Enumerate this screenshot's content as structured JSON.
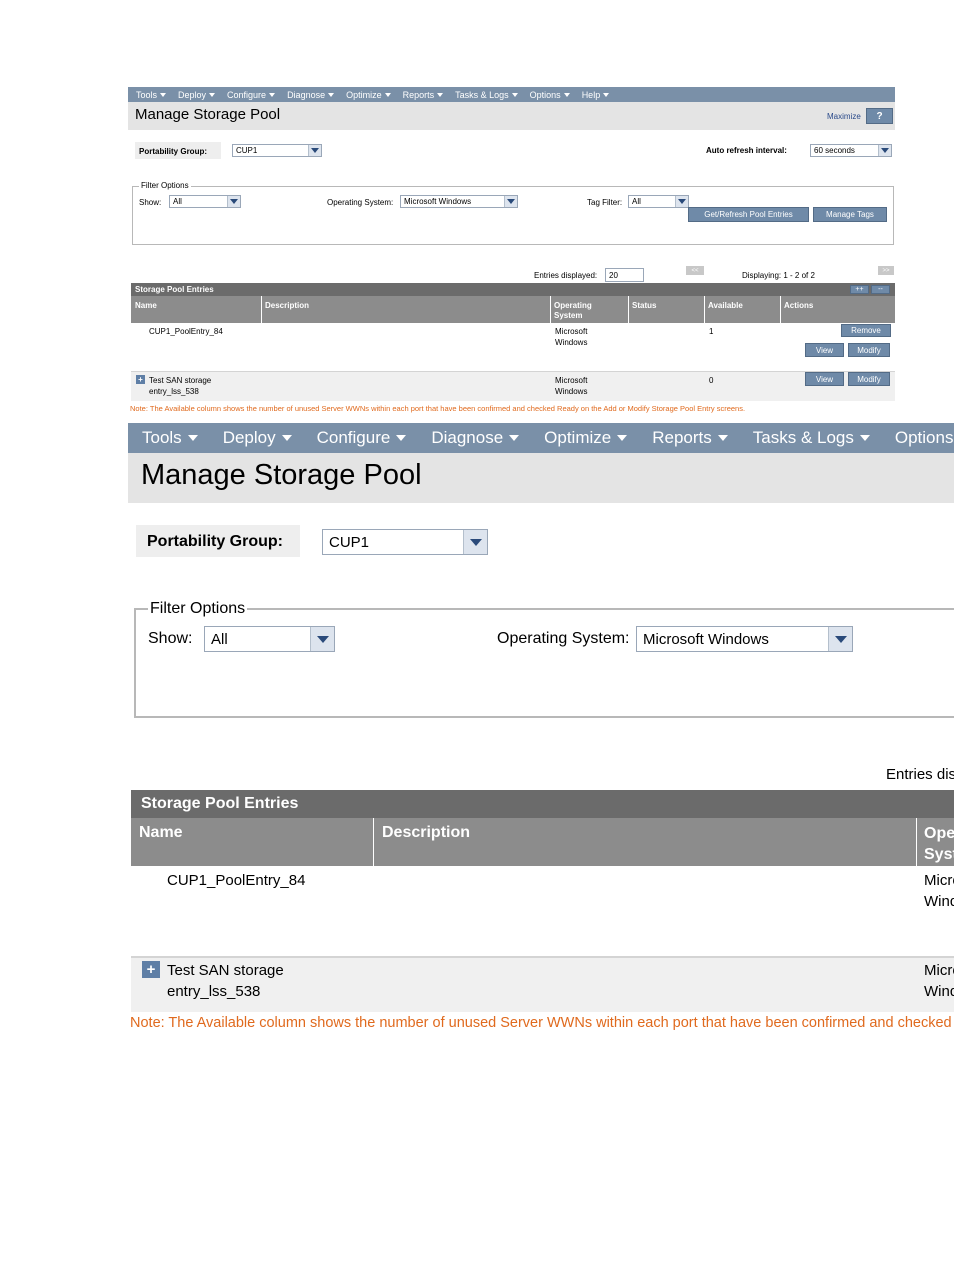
{
  "menu": [
    {
      "label": "Tools"
    },
    {
      "label": "Deploy"
    },
    {
      "label": "Configure"
    },
    {
      "label": "Diagnose"
    },
    {
      "label": "Optimize"
    },
    {
      "label": "Reports"
    },
    {
      "label": "Tasks & Logs"
    },
    {
      "label": "Options"
    },
    {
      "label": "Help"
    }
  ],
  "page": {
    "title": "Manage Storage Pool",
    "maximize_label": "Maximize",
    "help_label": "?"
  },
  "portability": {
    "label": "Portability Group:",
    "value": "CUP1"
  },
  "refresh": {
    "label": "Auto refresh interval:",
    "value": "60 seconds"
  },
  "filter": {
    "legend": "Filter Options",
    "show_label": "Show:",
    "show_value": "All",
    "os_label": "Operating System:",
    "os_value": "Microsoft Windows",
    "tag_label": "Tag Filter:",
    "tag_value": "All",
    "refresh_button": "Get/Refresh Pool Entries",
    "tags_button": "Manage Tags"
  },
  "paging": {
    "entries_label": "Entries displayed:",
    "entries_value": "20",
    "prev_label": "<<",
    "next_label": ">>",
    "displaying": "Displaying: 1 - 2 of 2",
    "expand_all": "++",
    "collapse_all": "--"
  },
  "table": {
    "section_title": "Storage Pool Entries",
    "columns": {
      "name": "Name",
      "description": "Description",
      "os_line1": "Operating",
      "os_line2": "System",
      "status": "Status",
      "available": "Available",
      "actions": "Actions"
    },
    "rows": [
      {
        "name_line1": "CUP1_PoolEntry_84",
        "name_line2": "",
        "os_line1": "Microsoft",
        "os_line2": "Windows",
        "available": "1",
        "actions": {
          "remove": "Remove",
          "view": "View",
          "modify": "Modify"
        }
      },
      {
        "name_line1": "Test SAN storage",
        "name_line2": "entry_lss_538",
        "os_line1": "Microsoft",
        "os_line2": "Windows",
        "available": "0",
        "actions": {
          "view": "View",
          "modify": "Modify"
        }
      }
    ]
  },
  "note": "Note: The Available column shows the number of unused Server WWNs within each port that have been confirmed and checked Ready on the Add or Modify Storage Pool Entry screens."
}
